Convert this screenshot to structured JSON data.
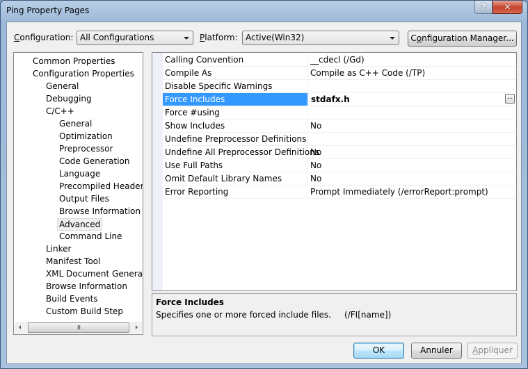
{
  "window": {
    "title": "Ping Property Pages",
    "help_glyph": "?",
    "close_glyph": "✕"
  },
  "toolbar": {
    "configuration_label_prefix": "",
    "configuration_label_accel": "C",
    "configuration_label_rest": "onfiguration:",
    "configuration_value": "All Configurations",
    "platform_label_accel": "P",
    "platform_label_rest": "latform:",
    "platform_value": "Active(Win32)",
    "config_manager_pre": "C",
    "config_manager_accel": "o",
    "config_manager_rest": "nfiguration Manager..."
  },
  "tree": {
    "items": [
      {
        "label": "Common Properties",
        "level": 0
      },
      {
        "label": "Configuration Properties",
        "level": 0
      },
      {
        "label": "General",
        "level": 1
      },
      {
        "label": "Debugging",
        "level": 1
      },
      {
        "label": "C/C++",
        "level": 1
      },
      {
        "label": "General",
        "level": 2
      },
      {
        "label": "Optimization",
        "level": 2
      },
      {
        "label": "Preprocessor",
        "level": 2
      },
      {
        "label": "Code Generation",
        "level": 2
      },
      {
        "label": "Language",
        "level": 2
      },
      {
        "label": "Precompiled Headers",
        "level": 2
      },
      {
        "label": "Output Files",
        "level": 2
      },
      {
        "label": "Browse Information",
        "level": 2
      },
      {
        "label": "Advanced",
        "level": 2,
        "selected": true
      },
      {
        "label": "Command Line",
        "level": 2
      },
      {
        "label": "Linker",
        "level": 1
      },
      {
        "label": "Manifest Tool",
        "level": 1
      },
      {
        "label": "XML Document Generator",
        "level": 1
      },
      {
        "label": "Browse Information",
        "level": 1
      },
      {
        "label": "Build Events",
        "level": 1
      },
      {
        "label": "Custom Build Step",
        "level": 1
      }
    ],
    "scroll_thumb_glyph": "III"
  },
  "grid": {
    "rows": [
      {
        "name": "Calling Convention",
        "value": "__cdecl (/Gd)"
      },
      {
        "name": "Compile As",
        "value": "Compile as C++ Code (/TP)"
      },
      {
        "name": "Disable Specific Warnings",
        "value": ""
      },
      {
        "name": "Force Includes",
        "value": "stdafx.h",
        "selected": true
      },
      {
        "name": "Force #using",
        "value": ""
      },
      {
        "name": "Show Includes",
        "value": "No"
      },
      {
        "name": "Undefine Preprocessor Definitions",
        "value": ""
      },
      {
        "name": "Undefine All Preprocessor Definitions",
        "value": "No"
      },
      {
        "name": "Use Full Paths",
        "value": "No"
      },
      {
        "name": "Omit Default Library Names",
        "value": "No"
      },
      {
        "name": "Error Reporting",
        "value": "Prompt Immediately (/errorReport:prompt)"
      }
    ],
    "ellipsis_label": "..."
  },
  "description": {
    "title": "Force Includes",
    "text": "Specifies one or more forced include files.     (/FI[name])"
  },
  "buttons": {
    "ok": "OK",
    "cancel": "Annuler",
    "apply_accel": "A",
    "apply_rest": "ppliquer"
  },
  "colors": {
    "selection": "#3399ff",
    "default_button_border": "#3c7fb1"
  }
}
